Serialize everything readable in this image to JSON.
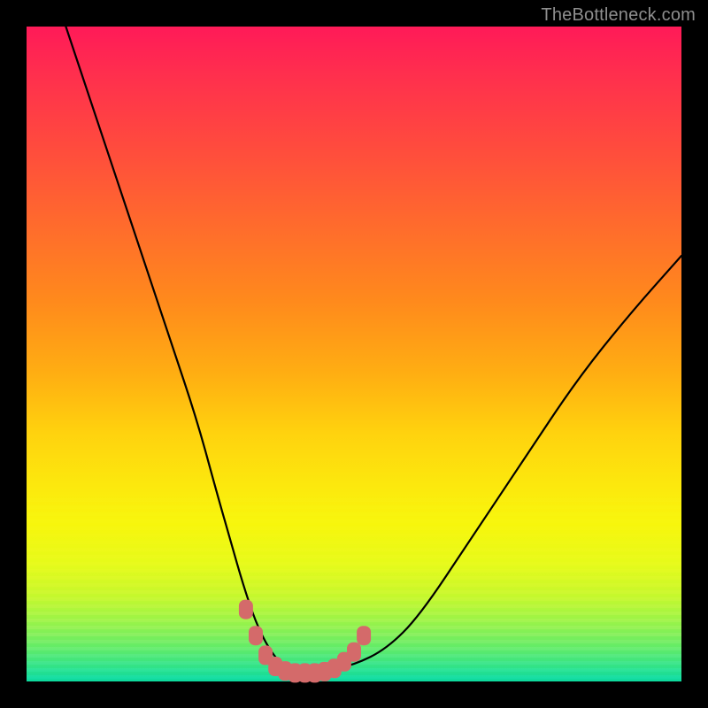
{
  "watermark": "TheBottleneck.com",
  "colors": {
    "frame_background": "#000000",
    "gradient_top": "#ff1a58",
    "gradient_mid": "#ffd20e",
    "gradient_bottom": "#0cd99f",
    "curve_stroke": "#000000",
    "marker_fill": "#d46a6a",
    "watermark_text": "#8e8e8e"
  },
  "chart_data": {
    "type": "line",
    "title": "",
    "xlabel": "",
    "ylabel": "",
    "xlim": [
      0,
      100
    ],
    "ylim": [
      0,
      100
    ],
    "series": [
      {
        "name": "bottleneck-curve",
        "x": [
          6,
          10,
          14,
          18,
          22,
          26,
          29,
          31,
          33,
          35,
          37,
          39,
          41,
          45,
          50,
          55,
          60,
          68,
          76,
          84,
          92,
          100
        ],
        "y": [
          100,
          88,
          76,
          64,
          52,
          40,
          29,
          22,
          15,
          9,
          5,
          2.5,
          1.5,
          1.5,
          2.5,
          5,
          10,
          22,
          34,
          46,
          56,
          65
        ]
      }
    ],
    "markers": {
      "name": "floor-markers",
      "x": [
        33.5,
        35,
        36.5,
        38,
        39.5,
        41,
        42.5,
        44,
        45.5,
        47,
        48.5,
        50,
        51.5
      ],
      "y": [
        11,
        7,
        4,
        2.3,
        1.6,
        1.3,
        1.3,
        1.3,
        1.5,
        2,
        3,
        4.5,
        7
      ]
    }
  }
}
